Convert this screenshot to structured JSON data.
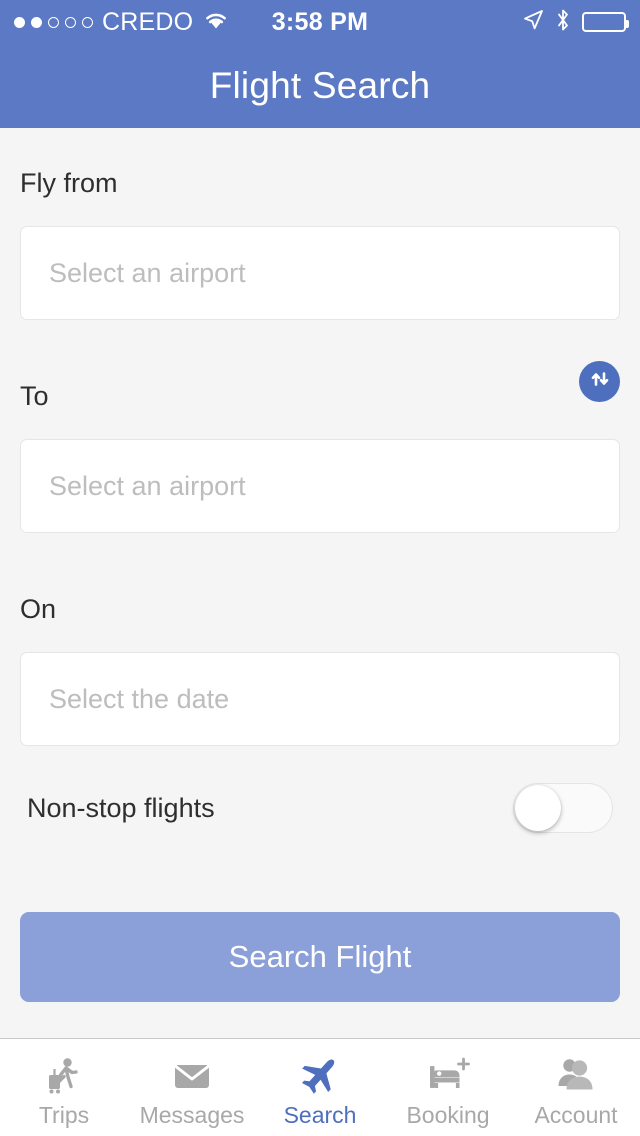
{
  "status_bar": {
    "carrier": "CREDO",
    "signal_dots_total": 5,
    "signal_dots_filled": 2,
    "time": "3:58 PM",
    "icons": [
      "wifi-icon",
      "location-arrow-icon",
      "bluetooth-icon",
      "battery-icon"
    ]
  },
  "header": {
    "title": "Flight Search",
    "background_color": "#5b79c4"
  },
  "form": {
    "from": {
      "label": "Fly from",
      "placeholder": "Select an airport",
      "value": ""
    },
    "to": {
      "label": "To",
      "placeholder": "Select an airport",
      "value": ""
    },
    "date": {
      "label": "On",
      "placeholder": "Select the date",
      "value": ""
    },
    "swap_button": {
      "icon": "swap-vertical-arrows-icon",
      "color": "#4e6fbd"
    },
    "nonstop": {
      "label": "Non-stop flights",
      "enabled": false
    },
    "submit": {
      "label": "Search Flight",
      "color": "#8b9fd8"
    }
  },
  "tabbar": {
    "active_index": 2,
    "active_color": "#4e6fbd",
    "inactive_color": "#a8a8a8",
    "items": [
      {
        "label": "Trips",
        "icon": "traveler-luggage-icon"
      },
      {
        "label": "Messages",
        "icon": "envelope-icon"
      },
      {
        "label": "Search",
        "icon": "airplane-icon"
      },
      {
        "label": "Booking",
        "icon": "bed-plus-icon"
      },
      {
        "label": "Account",
        "icon": "users-icon"
      }
    ]
  }
}
